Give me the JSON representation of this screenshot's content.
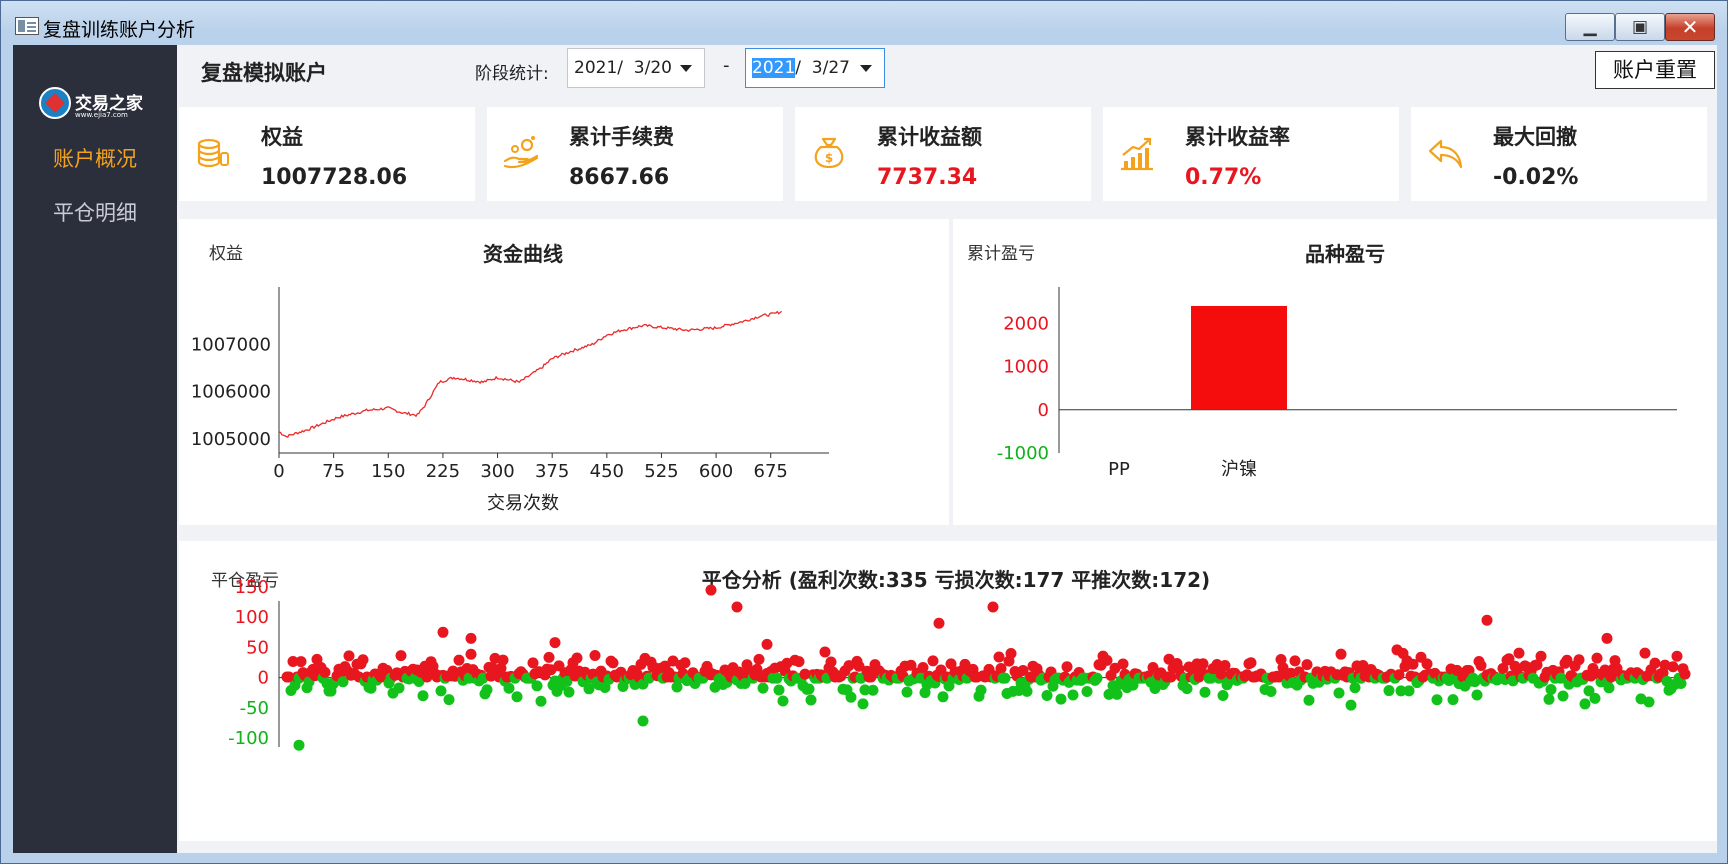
{
  "window": {
    "title": "复盘训练账户分析",
    "minimize": "▁",
    "maximize": "▣",
    "close": "✕"
  },
  "sidebar": {
    "logo_text": "交易之家",
    "logo_sub": "www.ejia7.com",
    "items": [
      {
        "label": "账户概况",
        "active": true
      },
      {
        "label": "平仓明细",
        "active": false
      }
    ]
  },
  "header": {
    "account_title": "复盘模拟账户",
    "period_label": "阶段统计:",
    "date_start": "2021/  3/20",
    "date_end_year": "2021",
    "date_end_rest": "/  3/27",
    "dash": "-",
    "reset_button": "账户重置"
  },
  "cards": [
    {
      "label": "权益",
      "value": "1007728.06",
      "icon": "coins-icon",
      "red": false
    },
    {
      "label": "累计手续费",
      "value": "8667.66",
      "icon": "hand-coins-icon",
      "red": false
    },
    {
      "label": "累计收益额",
      "value": "7737.34",
      "icon": "money-bag-icon",
      "red": true
    },
    {
      "label": "累计收益率",
      "value": "0.77%",
      "icon": "growth-chart-icon",
      "red": true
    },
    {
      "label": "最大回撤",
      "value": "-0.02%",
      "icon": "return-arrow-icon",
      "red": false
    }
  ],
  "colors": {
    "accent_orange": "#f4a21c",
    "profit_red": "#e8161f",
    "loss_green": "#12b21a",
    "sidebar": "#2b2e3b"
  },
  "chart_data": [
    {
      "type": "line",
      "title": "资金曲线",
      "ylabel": "权益",
      "xlabel": "交易次数",
      "x_ticks": [
        0,
        75,
        150,
        225,
        300,
        375,
        450,
        525,
        600,
        675
      ],
      "y_ticks": [
        1005000,
        1006000,
        1007000
      ],
      "xlim": [
        0,
        755
      ],
      "ylim": [
        1004700,
        1007750
      ],
      "series": [
        {
          "x": [
            0,
            10,
            40,
            80,
            120,
            150,
            170,
            190,
            200,
            220,
            240,
            260,
            280,
            300,
            330,
            360,
            375,
            400,
            430,
            450,
            470,
            500,
            530,
            560,
            600,
            640,
            660,
            680,
            690
          ],
          "values": [
            1005150,
            1005050,
            1005200,
            1005450,
            1005600,
            1005650,
            1005550,
            1005500,
            1005700,
            1006200,
            1006300,
            1006250,
            1006200,
            1006300,
            1006200,
            1006500,
            1006700,
            1006850,
            1007000,
            1007200,
            1007300,
            1007400,
            1007350,
            1007300,
            1007350,
            1007500,
            1007600,
            1007650,
            1007700
          ]
        }
      ]
    },
    {
      "type": "bar",
      "title": "品种盈亏",
      "ylabel": "累计盈亏",
      "categories": [
        "PP",
        "沪镍"
      ],
      "values": [
        0,
        2400
      ],
      "y_ticks": [
        -1000,
        0,
        1000,
        2000
      ],
      "ylim": [
        -1000,
        2700
      ]
    },
    {
      "type": "scatter",
      "title": "平仓分析 (盈利次数:335 亏损次数:177 平推次数:172)",
      "ylabel": "平仓盈亏",
      "y_ticks": [
        -100,
        -50,
        0,
        50,
        100,
        150
      ],
      "ylim": [
        -115,
        160
      ],
      "xlim": [
        0,
        700
      ],
      "notable_points": [
        {
          "x": 6,
          "y": -112
        },
        {
          "x": 78,
          "y": 75
        },
        {
          "x": 92,
          "y": 65
        },
        {
          "x": 134,
          "y": 58
        },
        {
          "x": 212,
          "y": 145
        },
        {
          "x": 225,
          "y": 117
        },
        {
          "x": 240,
          "y": 55
        },
        {
          "x": 353,
          "y": 117
        },
        {
          "x": 326,
          "y": 90
        },
        {
          "x": 600,
          "y": 95
        },
        {
          "x": 660,
          "y": 65
        },
        {
          "x": 178,
          "y": -72
        }
      ]
    }
  ]
}
